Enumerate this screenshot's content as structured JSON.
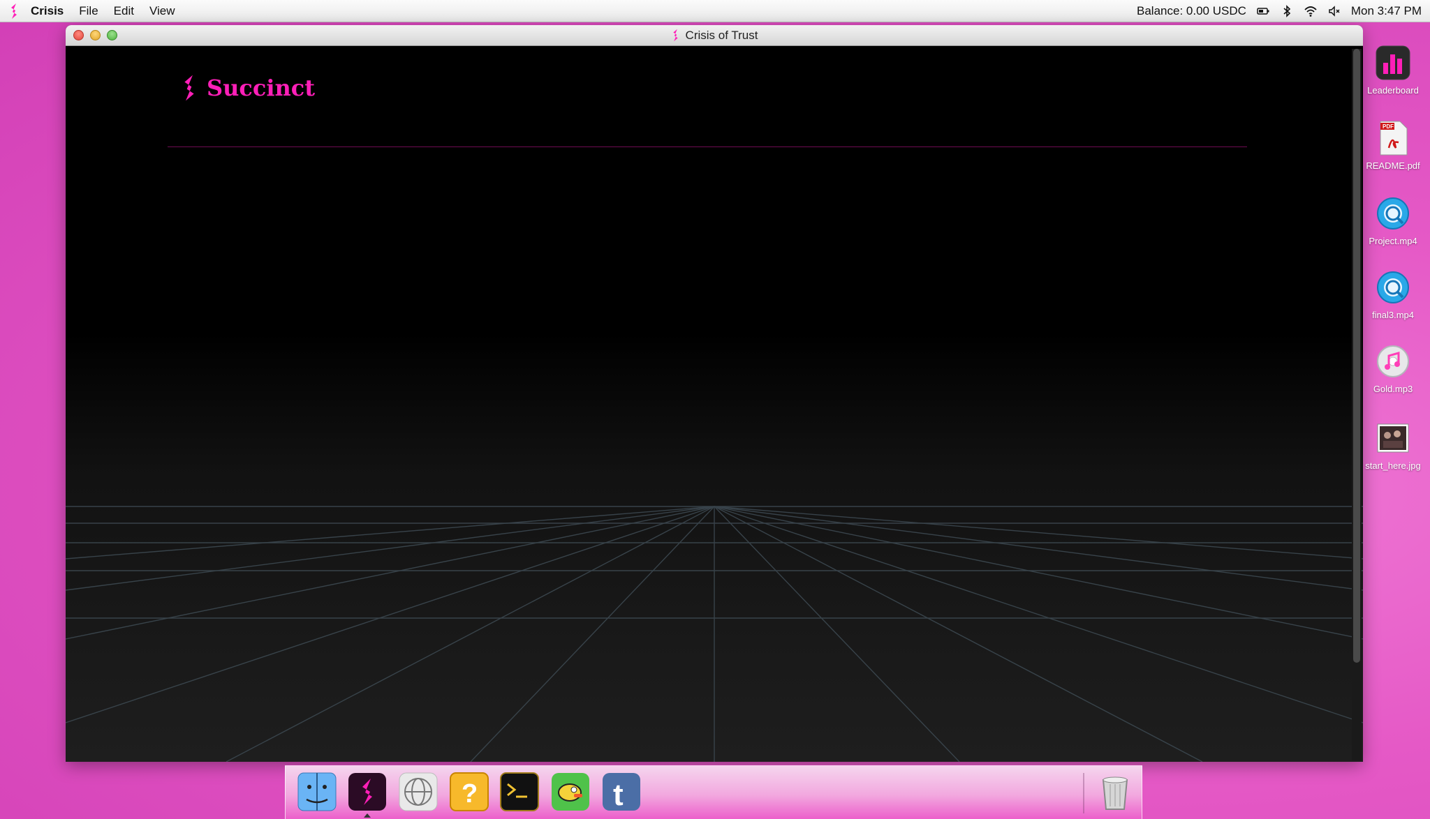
{
  "menubar": {
    "app_name": "Crisis",
    "menus": [
      "File",
      "Edit",
      "View"
    ],
    "balance": "Balance: 0.00 USDC",
    "clock": "Mon 3:47 PM",
    "status_icons": [
      "battery-icon",
      "bluetooth-icon",
      "wifi-icon",
      "speaker-muted-icon"
    ]
  },
  "window": {
    "title": "Crisis of Trust",
    "brand_name": "Succinct",
    "accent_color": "#ff1fb8"
  },
  "desktop_icons": [
    {
      "label": "Leaderboard",
      "icon": "leaderboard-icon"
    },
    {
      "label": "README.pdf",
      "icon": "pdf-icon"
    },
    {
      "label": "Project.mp4",
      "icon": "quicktime-icon"
    },
    {
      "label": "final3.mp4",
      "icon": "quicktime-icon"
    },
    {
      "label": "Gold.mp3",
      "icon": "itunes-icon"
    },
    {
      "label": "start_here.jpg",
      "icon": "image-icon"
    }
  ],
  "dock": [
    "finder-icon",
    "succinct-app-icon",
    "network-globe-icon",
    "question-block-icon",
    "terminal-icon",
    "flappy-bird-icon",
    "tumblr-icon",
    "trash-icon"
  ]
}
